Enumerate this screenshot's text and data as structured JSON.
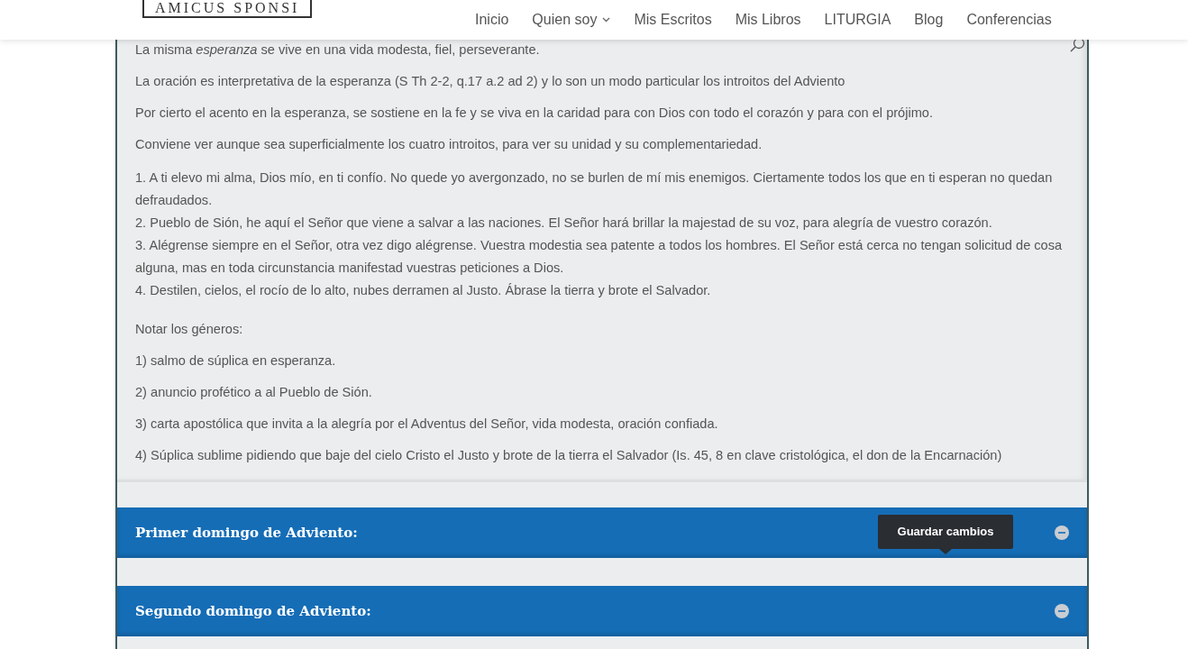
{
  "header": {
    "logo": "AMICUS SPONSI",
    "nav": [
      {
        "label": "Inicio",
        "has_dropdown": false
      },
      {
        "label": "Quien soy",
        "has_dropdown": true
      },
      {
        "label": "Mis Escritos",
        "has_dropdown": false
      },
      {
        "label": "Mis Libros",
        "has_dropdown": false
      },
      {
        "label": "LITURGIA",
        "has_dropdown": false
      },
      {
        "label": "Blog",
        "has_dropdown": false
      },
      {
        "label": "Conferencias",
        "has_dropdown": false
      }
    ]
  },
  "article": {
    "blocks": [
      {
        "kind": "paragraph",
        "text": "La misma *esperanza* se vive en una vida modesta, fiel, perseverante."
      },
      {
        "kind": "paragraph",
        "text": "La oración es interpretativa de la esperanza (S Th 2-2, q.17 a.2 ad 2) y lo son un modo particular los introitos del Adviento"
      },
      {
        "kind": "paragraph",
        "text": "Por cierto el acento en la esperanza, se sostiene en la fe y se viva en la caridad para con Dios con todo el corazón y para con el prójimo."
      },
      {
        "kind": "paragraph",
        "text": "Conviene ver aunque sea superficialmente los cuatro introitos, para ver su unidad y su complementariedad."
      },
      {
        "kind": "lines",
        "lines": [
          "1. A ti elevo mi alma, Dios mío, en ti confío. No quede yo avergonzado, no se burlen de mí mis enemigos. Ciertamente todos los que en ti esperan no quedan defraudados.",
          "2. Pueblo de Sión, he aquí el Señor que viene a salvar a las naciones. El Señor hará brillar la majestad de su voz, para alegría de vuestro corazón.",
          "3. Alégrense siempre en el Señor, otra vez digo alégrense. Vuestra modestia sea patente a todos los hombres. El Señor está cerca no tengan solicitud de cosa alguna, mas en toda circunstancia manifestad vuestras peticiones a Dios.",
          "4. Destilen, cielos, el rocío de lo alto, nubes derramen al Justo. Ábrase la tierra y brote el Salvador."
        ]
      },
      {
        "kind": "paragraph",
        "text": "Notar los géneros:"
      },
      {
        "kind": "paragraph",
        "text": "1) salmo de súplica en esperanza."
      },
      {
        "kind": "paragraph",
        "text": "2) anuncio profético a al Pueblo de Sión."
      },
      {
        "kind": "paragraph",
        "text": "3) carta apostólica que invita a la alegría por el Adventus del Señor, vida modesta, oración confiada."
      },
      {
        "kind": "paragraph",
        "text": "4) Súplica sublime pidiendo que baje del cielo Cristo el Justo y brote de la tierra el Salvador (Is. 45, 8 en clave cristológica, el don de la Encarnación)"
      }
    ]
  },
  "accordion": [
    {
      "title": "Primer domingo de Adviento:"
    },
    {
      "title": "Segundo domingo de Adviento:"
    }
  ],
  "tooltip": {
    "text": "Guardar cambios"
  }
}
